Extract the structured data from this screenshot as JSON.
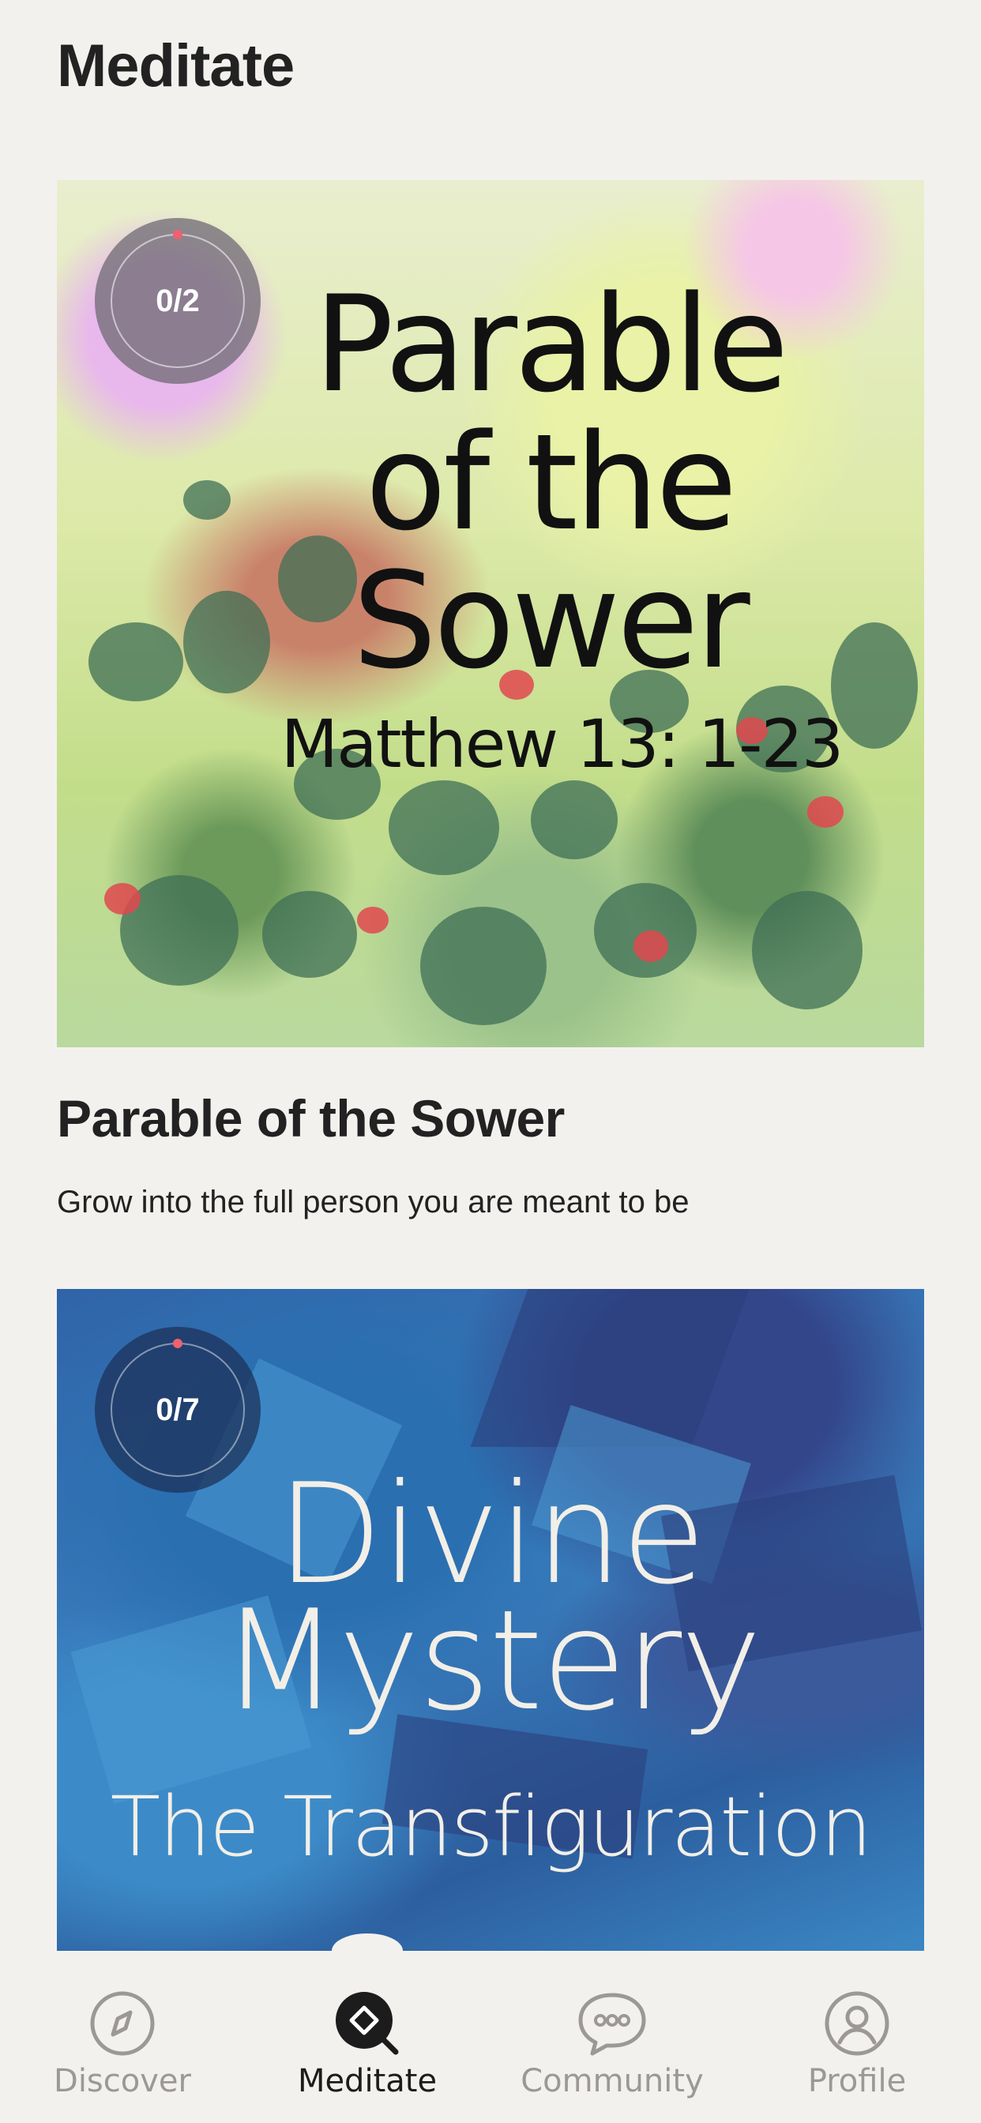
{
  "header": {
    "title": "Meditate"
  },
  "cards": [
    {
      "art_lines": [
        "Parable",
        "of the",
        "Sower",
        "Matthew 13: 1-23"
      ],
      "progress": "0/2",
      "title": "Parable of the Sower",
      "subtitle": "Grow into the full person you are meant to be"
    },
    {
      "art_lines": [
        "Divine",
        "Mystery",
        "The Transfiguration"
      ],
      "progress": "0/7"
    }
  ],
  "tabs": [
    {
      "label": "Discover",
      "icon": "compass-icon"
    },
    {
      "label": "Meditate",
      "icon": "meditate-icon",
      "active": true
    },
    {
      "label": "Community",
      "icon": "chat-bubble-icon"
    },
    {
      "label": "Profile",
      "icon": "profile-icon"
    }
  ],
  "colors": {
    "background": "#f3f1ee",
    "text": "#222222",
    "inactive_tab": "#9b9895",
    "progress_dot": "#f06070"
  }
}
